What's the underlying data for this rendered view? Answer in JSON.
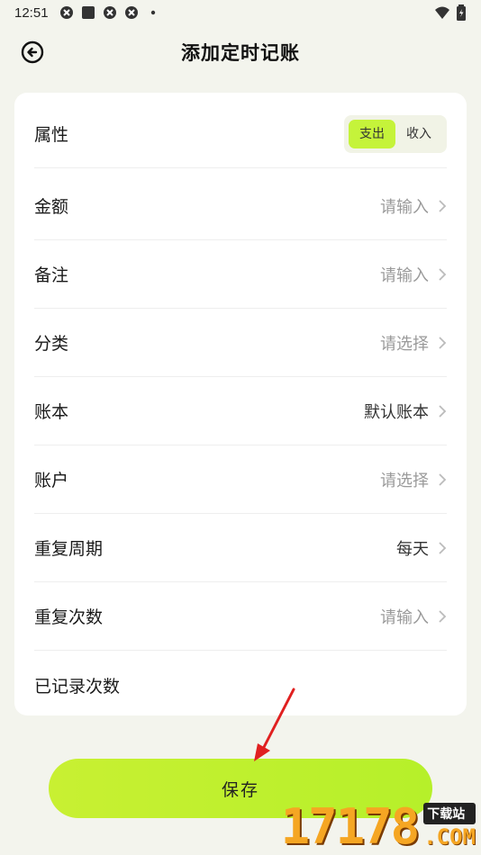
{
  "status": {
    "time": "12:51"
  },
  "header": {
    "title": "添加定时记账"
  },
  "type_row": {
    "label": "属性",
    "options": [
      "支出",
      "收入"
    ],
    "selected": "支出"
  },
  "rows": [
    {
      "label": "金额",
      "value": "请输入",
      "placeholder": true
    },
    {
      "label": "备注",
      "value": "请输入",
      "placeholder": true
    },
    {
      "label": "分类",
      "value": "请选择",
      "placeholder": true
    },
    {
      "label": "账本",
      "value": "默认账本",
      "placeholder": false
    },
    {
      "label": "账户",
      "value": "请选择",
      "placeholder": true
    },
    {
      "label": "重复周期",
      "value": "每天",
      "placeholder": false
    },
    {
      "label": "重复次数",
      "value": "请输入",
      "placeholder": true
    }
  ],
  "recorded_row": {
    "label": "已记录次数"
  },
  "save_button": {
    "label": "保存"
  },
  "watermark": {
    "number": "17178",
    "tag": "下载站",
    "domain": ".COM"
  },
  "colors": {
    "accent": "#c5f33a",
    "background": "#f3f4ed",
    "card": "#ffffff"
  }
}
